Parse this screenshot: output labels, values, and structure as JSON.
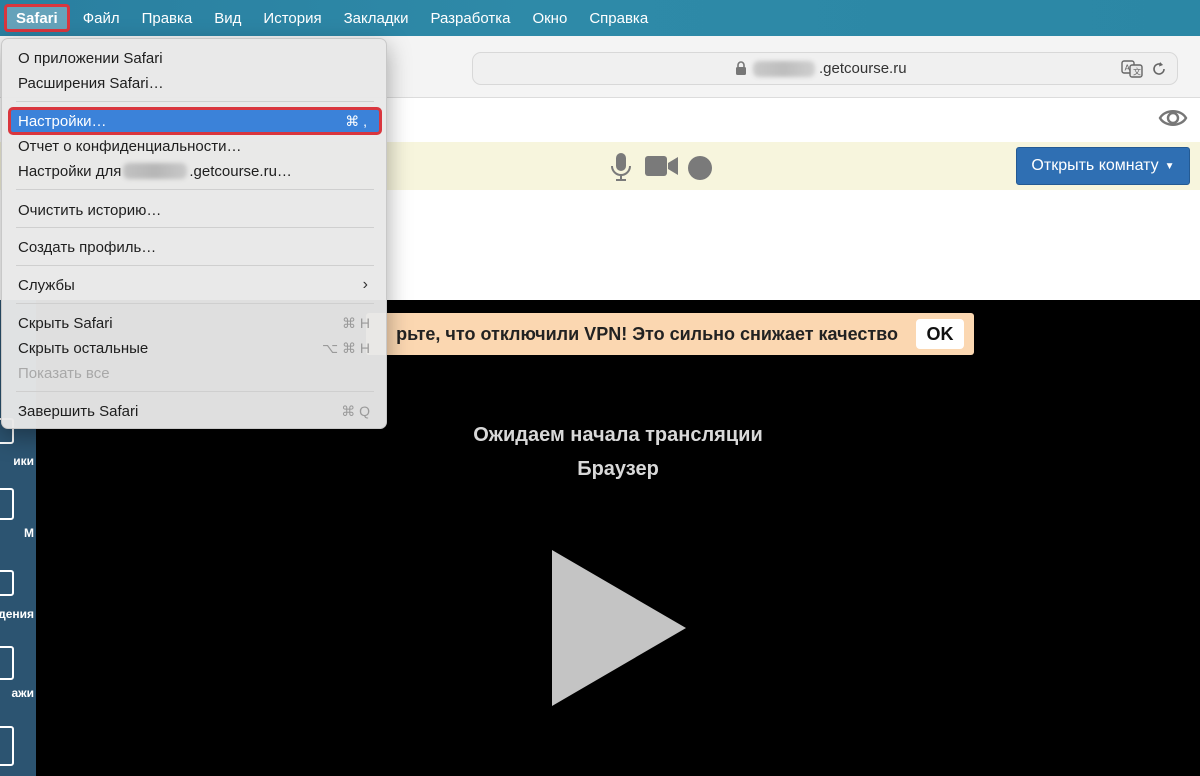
{
  "menubar": {
    "app": "Safari",
    "items": [
      "Файл",
      "Правка",
      "Вид",
      "История",
      "Закладки",
      "Разработка",
      "Окно",
      "Справка"
    ]
  },
  "browser": {
    "url_suffix": ".getcourse.ru"
  },
  "conference": {
    "open_room_label": "Открыть комнату"
  },
  "sidebar": {
    "labels": [
      "ики",
      "М",
      "дения",
      "ажи"
    ]
  },
  "video": {
    "vpn_warning": "рьте, что отключили VPN! Это сильно снижает качество",
    "ok_label": "OK",
    "waiting_title": "Ожидаем начала трансляции",
    "waiting_subtitle": "Браузер"
  },
  "safari_menu": {
    "about": "О приложении Safari",
    "extensions": "Расширения Safari…",
    "settings": "Настройки…",
    "settings_shortcut": "⌘ ,",
    "privacy_report": "Отчет о конфиденциальности…",
    "site_settings_prefix": "Настройки для",
    "site_settings_suffix": ".getcourse.ru…",
    "clear_history": "Очистить историю…",
    "create_profile": "Создать профиль…",
    "services": "Службы",
    "hide_safari": "Скрыть Safari",
    "hide_safari_shortcut": "⌘ H",
    "hide_others": "Скрыть остальные",
    "hide_others_shortcut": "⌥ ⌘ H",
    "show_all": "Показать все",
    "quit": "Завершить Safari",
    "quit_shortcut": "⌘ Q"
  }
}
